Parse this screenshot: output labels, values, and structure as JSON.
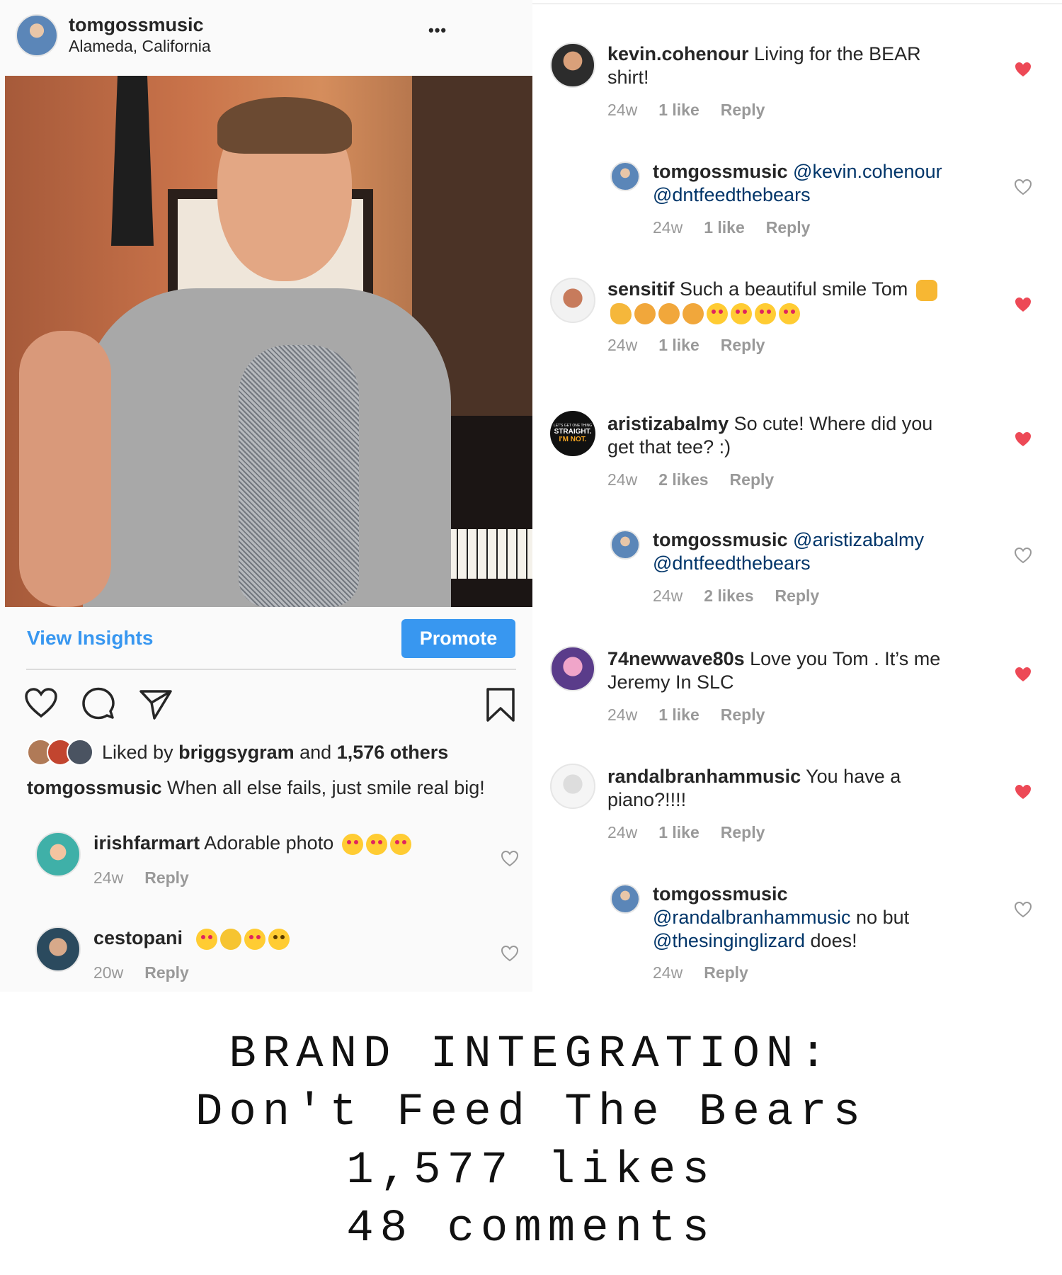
{
  "post": {
    "username": "tomgossmusic",
    "location": "Alameda, California",
    "more_label": "•••",
    "insights_label": "View Insights",
    "promote_label": "Promote",
    "liked_prefix": "Liked by ",
    "liked_user": "briggsygram",
    "liked_mid": " and ",
    "liked_others": "1,576 others",
    "caption_user": "tomgossmusic",
    "caption_text": " When all else fails, just smile real big!"
  },
  "left_comments": [
    {
      "user": "irishfarmart",
      "text": " Adorable photo",
      "time": "24w",
      "reply": "Reply"
    },
    {
      "user": "cestopani",
      "text": "",
      "time": "20w",
      "reply": "Reply"
    }
  ],
  "right_comments": [
    {
      "user": "kevin.cohenour",
      "text": " Living for the BEAR",
      "text2": "shirt!",
      "time": "24w",
      "likes": "1 like",
      "reply": "Reply"
    },
    {
      "user": "tomgossmusic",
      "mention1": " @kevin.cohenour",
      "mention2": "@dntfeedthebears",
      "time": "24w",
      "likes": "1 like",
      "reply": "Reply"
    },
    {
      "user": "sensitif",
      "text": " Such a beautiful smile Tom",
      "time": "24w",
      "likes": "1 like",
      "reply": "Reply"
    },
    {
      "user": "aristizabalmy",
      "text": " So cute! Where did you",
      "text2": "get that tee? :)",
      "time": "24w",
      "likes": "2 likes",
      "reply": "Reply"
    },
    {
      "user": "tomgossmusic",
      "mention1": " @aristizabalmy",
      "mention2": "@dntfeedthebears",
      "time": "24w",
      "likes": "2 likes",
      "reply": "Reply"
    },
    {
      "user": "74newwave80s",
      "text": " Love you Tom . It’s me",
      "text2": "Jeremy In SLC",
      "time": "24w",
      "likes": "1 like",
      "reply": "Reply"
    },
    {
      "user": "randalbranhammusic",
      "text": " You have a",
      "text2": "piano?!!!!",
      "time": "24w",
      "likes": "1 like",
      "reply": "Reply"
    },
    {
      "user": "tomgossmusic",
      "mention1": "@randalbranhammusic",
      "plain1": " no but",
      "mention2": "@thesinginglizard",
      "plain2": " does!",
      "time": "24w",
      "reply": "Reply"
    }
  ],
  "avatar_badge": {
    "line1": "LET'S GET ONE THING",
    "line2": "STRAIGHT.",
    "line3": "I'M NOT."
  },
  "footer": {
    "line1": "BRAND INTEGRATION:",
    "line2": "Don't Feed The Bears",
    "line3": "1,577 likes",
    "line4": "48 comments"
  },
  "colors": {
    "accent": "#3897f0",
    "heart_red": "#ed4956",
    "mention": "#003569",
    "muted": "#999999"
  }
}
